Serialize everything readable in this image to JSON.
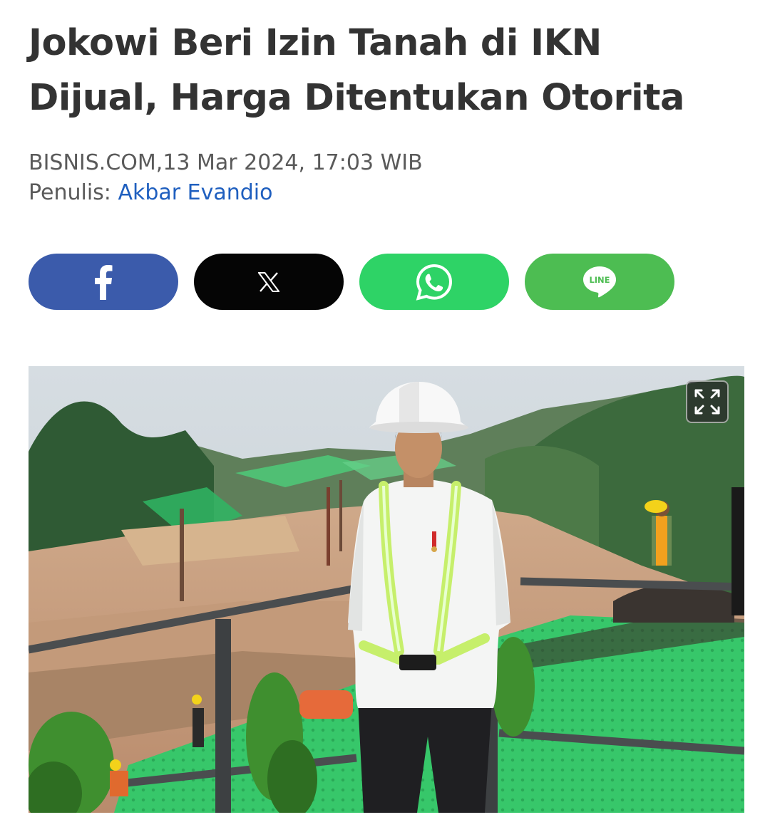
{
  "article": {
    "headline_line1": "Jokowi Beri Izin Tanah di IKN",
    "headline_line2": "Dijual, Harga Ditentukan Otorita",
    "source_datetime": "BISNIS.COM,13 Mar 2024, 17:03 WIB",
    "author_label": "Penulis: ",
    "author_name": "Akbar Evandio"
  },
  "share": {
    "buttons": [
      {
        "network": "facebook",
        "icon": "facebook-icon",
        "color": "#3b5bab"
      },
      {
        "network": "x",
        "icon": "x-logo-icon",
        "color": "#050505"
      },
      {
        "network": "whatsapp",
        "icon": "whatsapp-icon",
        "color": "#2ed366"
      },
      {
        "network": "line",
        "icon": "line-icon",
        "icon_text": "LINE",
        "color": "#4dbd52"
      }
    ]
  },
  "hero_image": {
    "expand_icon": "expand-icon"
  },
  "colors": {
    "headline": "#333333",
    "meta": "#5a5a5a",
    "author_link": "#1f5fbf"
  }
}
